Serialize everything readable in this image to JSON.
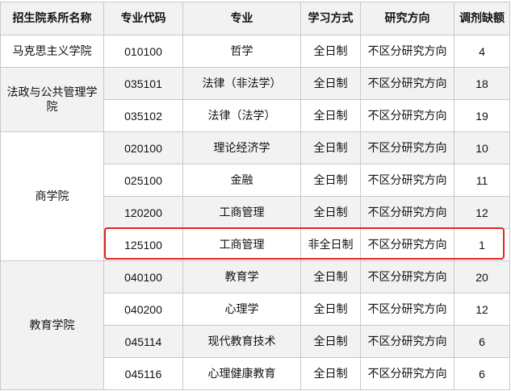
{
  "headers": {
    "college": "招生院系所名称",
    "code": "专业代码",
    "major": "专业",
    "mode": "学习方式",
    "direction": "研究方向",
    "quota": "调剂缺额"
  },
  "groups": [
    {
      "college": "马克思主义学院",
      "rows": [
        {
          "code": "010100",
          "major": "哲学",
          "mode": "全日制",
          "direction": "不区分研究方向",
          "quota": "4"
        }
      ]
    },
    {
      "college": "法政与公共管理学院",
      "rows": [
        {
          "code": "035101",
          "major": "法律（非法学）",
          "mode": "全日制",
          "direction": "不区分研究方向",
          "quota": "18"
        },
        {
          "code": "035102",
          "major": "法律（法学）",
          "mode": "全日制",
          "direction": "不区分研究方向",
          "quota": "19"
        }
      ]
    },
    {
      "college": "商学院",
      "rows": [
        {
          "code": "020100",
          "major": "理论经济学",
          "mode": "全日制",
          "direction": "不区分研究方向",
          "quota": "10"
        },
        {
          "code": "025100",
          "major": "金融",
          "mode": "全日制",
          "direction": "不区分研究方向",
          "quota": "11"
        },
        {
          "code": "120200",
          "major": "工商管理",
          "mode": "全日制",
          "direction": "不区分研究方向",
          "quota": "12"
        },
        {
          "code": "125100",
          "major": "工商管理",
          "mode": "非全日制",
          "direction": "不区分研究方向",
          "quota": "1"
        }
      ]
    },
    {
      "college": "教育学院",
      "rows": [
        {
          "code": "040100",
          "major": "教育学",
          "mode": "全日制",
          "direction": "不区分研究方向",
          "quota": "20"
        },
        {
          "code": "040200",
          "major": "心理学",
          "mode": "全日制",
          "direction": "不区分研究方向",
          "quota": "12"
        },
        {
          "code": "045114",
          "major": "现代教育技术",
          "mode": "全日制",
          "direction": "不区分研究方向",
          "quota": "6"
        },
        {
          "code": "045116",
          "major": "心理健康教育",
          "mode": "全日制",
          "direction": "不区分研究方向",
          "quota": "6"
        }
      ]
    }
  ],
  "colors": {
    "highlight_border": "#e8231d",
    "alt_row_bg": "#f2f2f2",
    "grid": "#c9c9c9"
  }
}
